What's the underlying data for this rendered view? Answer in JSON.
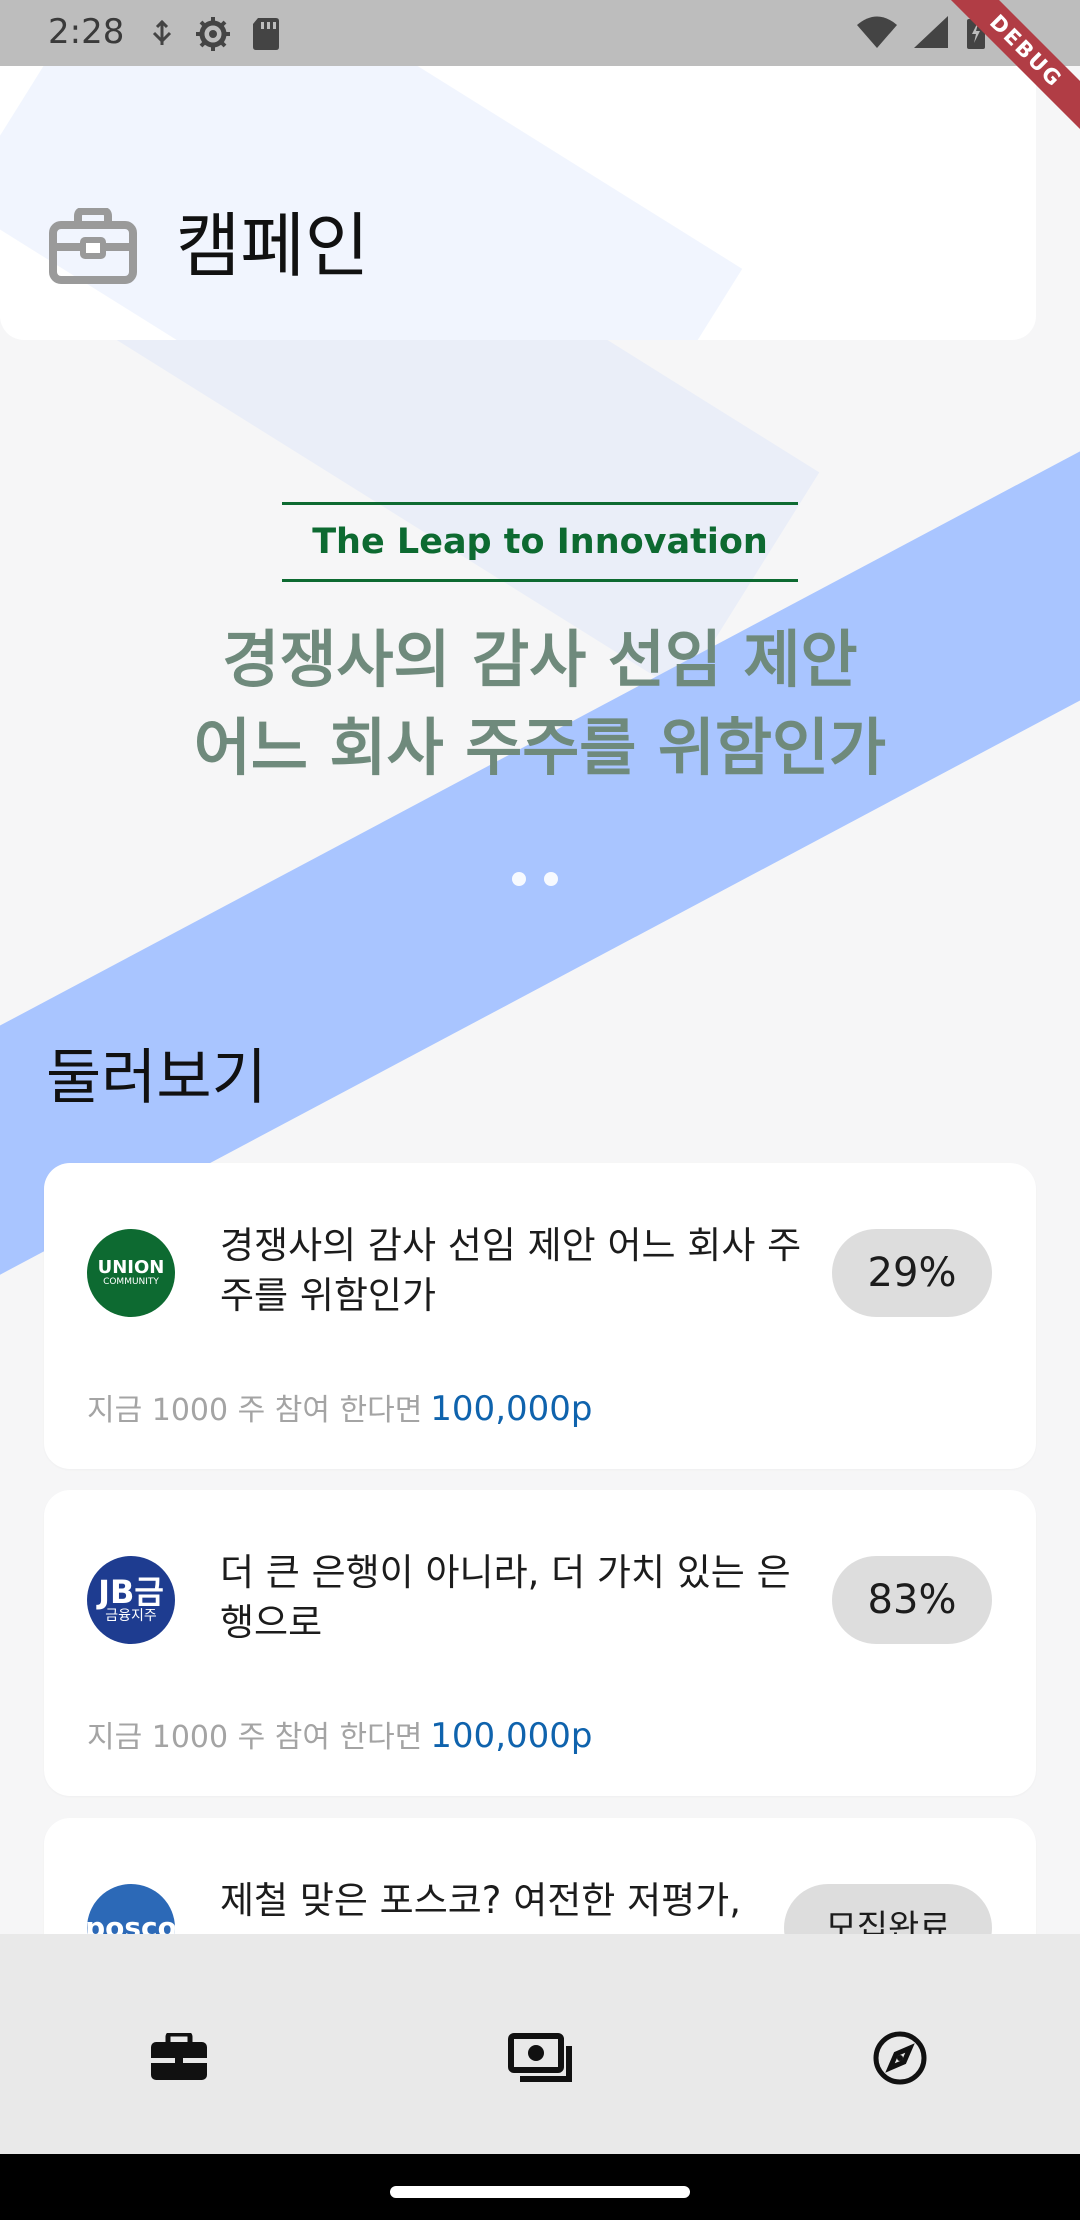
{
  "status_bar": {
    "time": "2:28",
    "debug_label": "DEBUG"
  },
  "header": {
    "title": "캠페인",
    "icon": "briefcase-icon"
  },
  "banner": {
    "subtitle": "The Leap to Innovation",
    "title": "경쟁사의 감사 선임 제안\n어느 회사 주주를 위함인가",
    "colors": {
      "subtitle": "#0d6a31",
      "title": "#6f8a7c"
    }
  },
  "browse": {
    "title": "둘러보기",
    "cards": [
      {
        "logo_text": "UNION",
        "logo_subtext": "COMMUNITY",
        "title": "경쟁사의 감사 선임 제안 어느 회사 주주를 위함인가",
        "percent": "29%",
        "footer_prefix": "지금 1000 주 참여 한다면",
        "reward": "100,000p"
      },
      {
        "logo_text": "JB금",
        "logo_subtext": "금융지주",
        "title": "더 큰 은행이 아니라, 더 가치 있는 은행으로",
        "percent": "83%",
        "footer_prefix": "지금 1000 주 참여 한다면",
        "reward": "100,000p"
      },
      {
        "logo_text": "posco",
        "logo_subtext": "",
        "title": "제철 맞은 포스코? 여전한 저평가,",
        "percent": "모집완료",
        "footer_prefix": "",
        "reward": ""
      }
    ]
  },
  "bottom_nav": {
    "items": [
      {
        "icon": "briefcase-icon"
      },
      {
        "icon": "money-stack-icon"
      },
      {
        "icon": "compass-icon"
      }
    ]
  },
  "colors": {
    "accent_blue": "#0f63ad",
    "light_blue_stripe": "#a9c5ff",
    "debug_red": "#b13d45"
  }
}
